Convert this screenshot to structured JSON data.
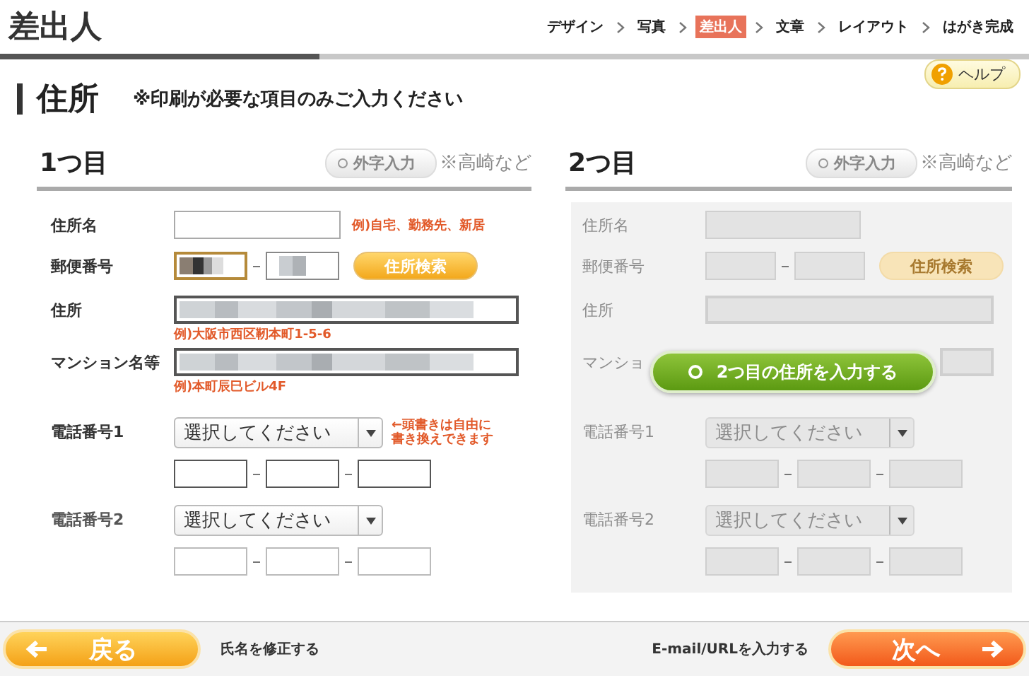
{
  "header": {
    "title": "差出人",
    "steps": [
      {
        "label": "デザイン",
        "selected": false
      },
      {
        "label": "写真",
        "selected": false
      },
      {
        "label": "差出人",
        "selected": true
      },
      {
        "label": "文章",
        "selected": false
      },
      {
        "label": "レイアウト",
        "selected": false
      },
      {
        "label": "はがき完成",
        "selected": false
      }
    ],
    "progress": {
      "level": 0.31
    }
  },
  "section": {
    "title": "住所",
    "note": "※印刷が必要な項目のみご入力ください",
    "help_button": "ヘルプ"
  },
  "columns": [
    {
      "title": "1つ目",
      "gaiji_button": "外字入力",
      "gaiji_note": "※高崎など",
      "disabled": false,
      "rows": [
        {
          "kind": "name",
          "label": "住所名",
          "hint": "例)自宅、勤務先、新居"
        },
        {
          "kind": "postal",
          "label": "郵便番号",
          "fields": [
            {
              "redacted": true,
              "focused": true
            },
            {
              "redacted": true,
              "focused": false
            }
          ],
          "button": "住所検索"
        },
        {
          "kind": "wide",
          "label": "住所",
          "redacted": true,
          "hint": "例)大阪市西区靭本町1-5-6"
        },
        {
          "kind": "wide",
          "label": "マンション名等",
          "redacted": true,
          "hint": "例)本町辰巳ビル4F"
        },
        {
          "kind": "phone",
          "label": "電話番号1",
          "select": "選択してください",
          "note": "←頭書きは自由に書き換えできます",
          "strong": true
        },
        {
          "kind": "phone",
          "label": "電話番号2",
          "select": "選択してください",
          "strong": false
        }
      ]
    },
    {
      "title": "2つ目",
      "gaiji_button": "外字入力",
      "gaiji_note": "※高崎など",
      "disabled": true,
      "overlay_button": "2つ目の住所を入力する",
      "rows": [
        {
          "kind": "name",
          "label": "住所名"
        },
        {
          "kind": "postal",
          "label": "郵便番号",
          "fields": [
            {
              "redacted": false
            },
            {
              "redacted": false
            }
          ],
          "button": "住所検索"
        },
        {
          "kind": "wide",
          "label": "住所",
          "redacted": false
        },
        {
          "kind": "wide",
          "label": "マンショ",
          "redacted": false,
          "partly_hidden": true
        },
        {
          "kind": "phone",
          "label": "電話番号1",
          "select": "選択してください"
        },
        {
          "kind": "phone",
          "label": "電話番号2",
          "select": "選択してください"
        }
      ]
    }
  ],
  "footer": {
    "back_button": "戻る",
    "back_note": "氏名を修正する",
    "next_note": "E-mail/URLを入力する",
    "next_button": "次へ"
  }
}
